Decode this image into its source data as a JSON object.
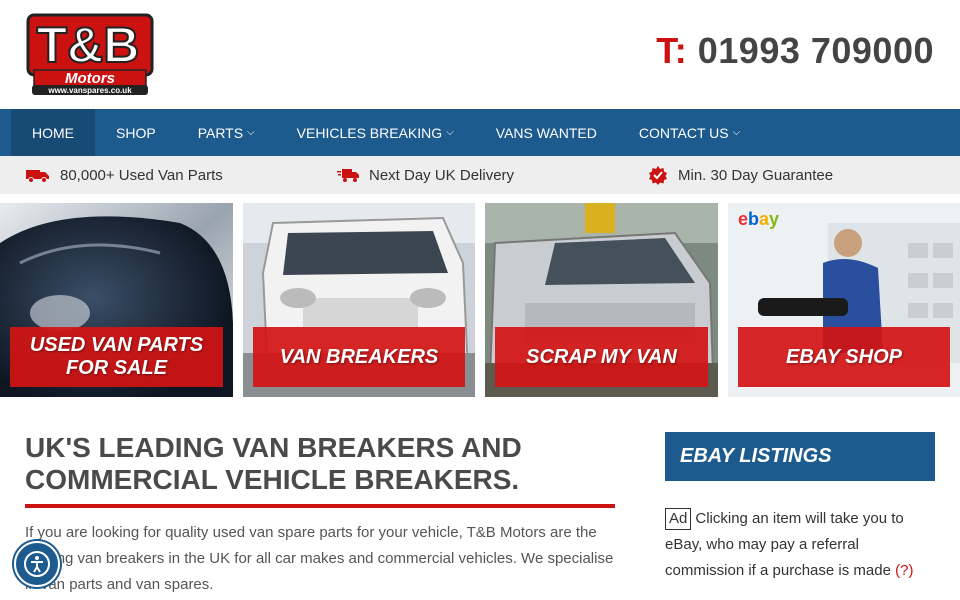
{
  "header": {
    "logo_main": "T&B",
    "logo_sub": "Motors",
    "logo_url": "www.vanspares.co.uk",
    "phone_prefix": "T:",
    "phone_number": "01993 709000"
  },
  "nav": {
    "items": [
      {
        "label": "HOME",
        "active": true,
        "dropdown": false
      },
      {
        "label": "SHOP",
        "active": false,
        "dropdown": false
      },
      {
        "label": "PARTS",
        "active": false,
        "dropdown": true
      },
      {
        "label": "VEHICLES BREAKING",
        "active": false,
        "dropdown": true
      },
      {
        "label": "VANS WANTED",
        "active": false,
        "dropdown": false
      },
      {
        "label": "CONTACT US",
        "active": false,
        "dropdown": true
      }
    ]
  },
  "usp": {
    "items": [
      {
        "icon": "van-icon",
        "text": "80,000+ Used Van Parts"
      },
      {
        "icon": "delivery-truck-icon",
        "text": "Next Day UK Delivery"
      },
      {
        "icon": "guarantee-badge-icon",
        "text": "Min. 30 Day Guarantee"
      }
    ]
  },
  "tiles": [
    {
      "label": "USED VAN PARTS FOR SALE"
    },
    {
      "label": "VAN BREAKERS"
    },
    {
      "label": "SCRAP MY VAN"
    },
    {
      "label": "EBAY SHOP",
      "logo": "ebay"
    }
  ],
  "main": {
    "title": "UK'S LEADING VAN BREAKERS AND COMMERCIAL VEHICLE BREAKERS.",
    "intro": "If you are looking for quality used van spare parts for your vehicle, T&B Motors are the leading van breakers in the UK for all car makes and commercial vehicles. We specialise in van parts and van spares."
  },
  "sidebar": {
    "heading": "EBAY LISTINGS",
    "ad_label": "Ad",
    "note": "Clicking an item will take you to eBay, who may pay a referral commission if a purchase is made",
    "help_link": "(?)"
  },
  "colors": {
    "brand_blue": "#1d5a8e",
    "brand_red": "#cc1111"
  }
}
